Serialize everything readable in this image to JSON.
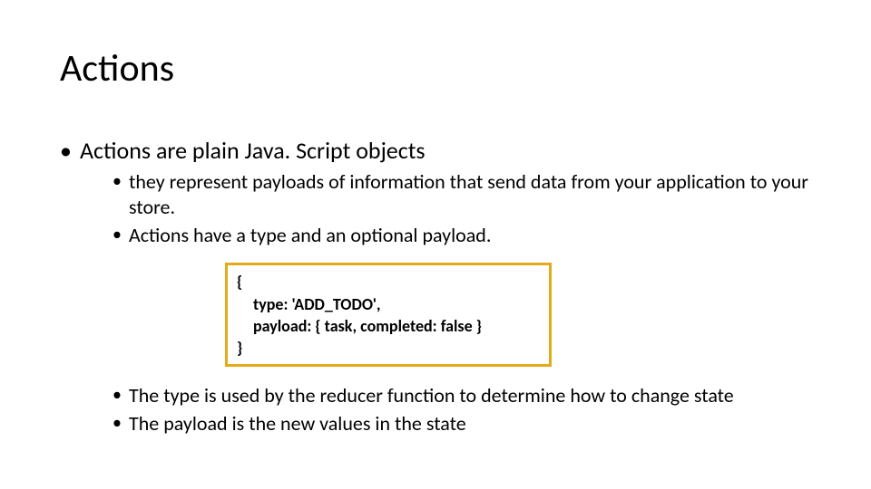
{
  "title": "Actions",
  "bullet1": "Actions are plain Java. Script objects",
  "sub1a": "they represent payloads of information that send data from your application to your store.",
  "sub1b": " Actions have a type and an optional payload.",
  "code": {
    "line1": "{",
    "line2": "type: 'ADD_TODO',",
    "line3": "payload: { task, completed: false }",
    "line4": "}"
  },
  "sub1c": "The type is used by the reducer function to determine how to change state",
  "sub1d": "The payload is the new values in the state",
  "colors": {
    "border": "#e3aa1a"
  }
}
